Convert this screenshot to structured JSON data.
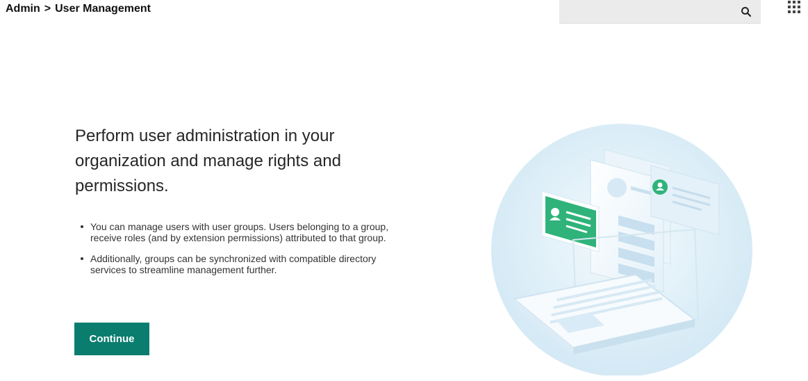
{
  "breadcrumb": {
    "root": "Admin",
    "separator": ">",
    "current": "User Management"
  },
  "search": {
    "placeholder": "",
    "icon": "search-icon"
  },
  "apps_menu": {
    "icon": "grid-icon"
  },
  "main": {
    "headline": "Perform user administration in your organization and manage rights and permissions.",
    "bullets": [
      "You can manage users with user groups. Users belonging to a group, receive roles (and by extension permissions) attributed to that group.",
      "Additionally, groups can be synchronized with compatible directory services to streamline management further."
    ],
    "continue_label": "Continue"
  },
  "colors": {
    "accent": "#0a7d6f",
    "search_bg": "#ebebeb",
    "illustration_green": "#2fb37a",
    "illustration_blue": "#cfe6f3"
  }
}
